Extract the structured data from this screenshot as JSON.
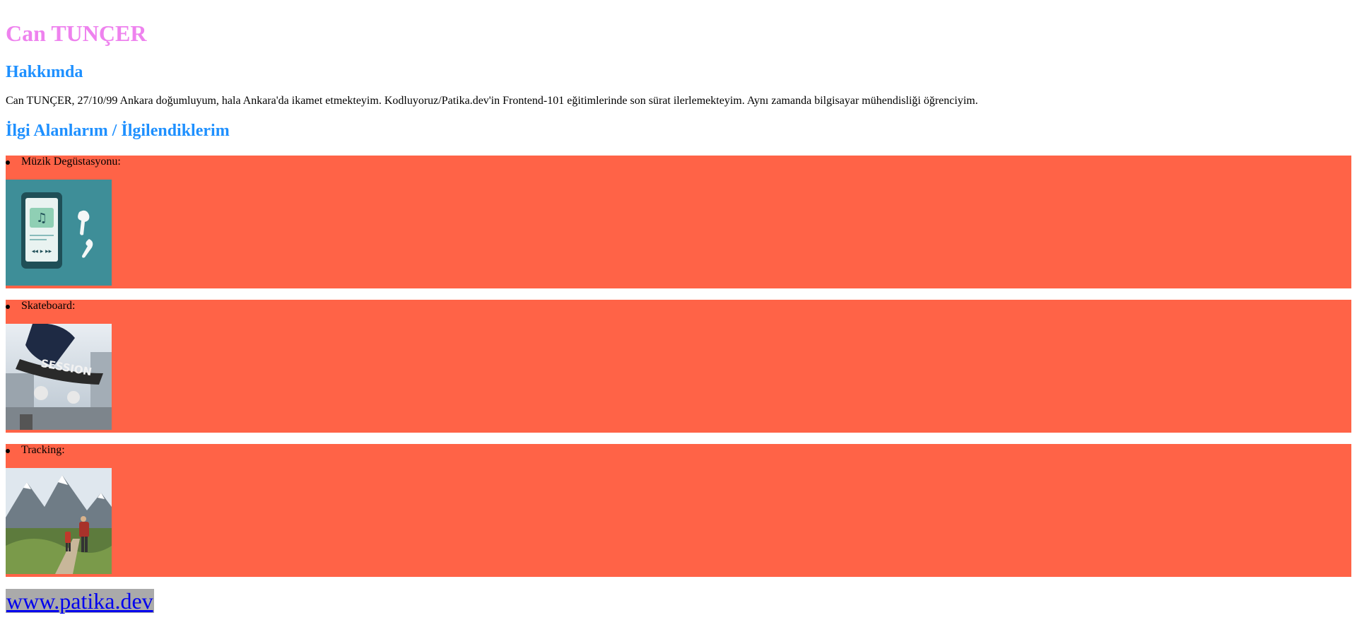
{
  "header": {
    "name": "Can TUNÇER"
  },
  "about": {
    "title": "Hakkımda",
    "text": "Can TUNÇER, 27/10/99 Ankara doğumluyum, hala Ankara'da ikamet etmekteyim. Kodluyoruz/Patika.dev'in Frontend-101 eğitimlerinde son sürat ilerlemekteyim. Aynı zamanda bilgisayar mühendisliği öğrenciyim."
  },
  "interests": {
    "title": "İlgi Alanlarım / İlgilendiklerim",
    "items": [
      {
        "label": "Müzik Degüstasyonu:",
        "icon": "music-player-image"
      },
      {
        "label": "Skateboard:",
        "icon": "skateboard-image"
      },
      {
        "label": "Tracking:",
        "icon": "mountain-hiking-image"
      }
    ]
  },
  "footer": {
    "link_text": "www.patika.dev"
  },
  "colors": {
    "name": "#ee82ee",
    "section_title": "#1e90ff",
    "interest_background": "#ff6347",
    "link_background": "#aaaaaa",
    "link": "#0000ee"
  }
}
